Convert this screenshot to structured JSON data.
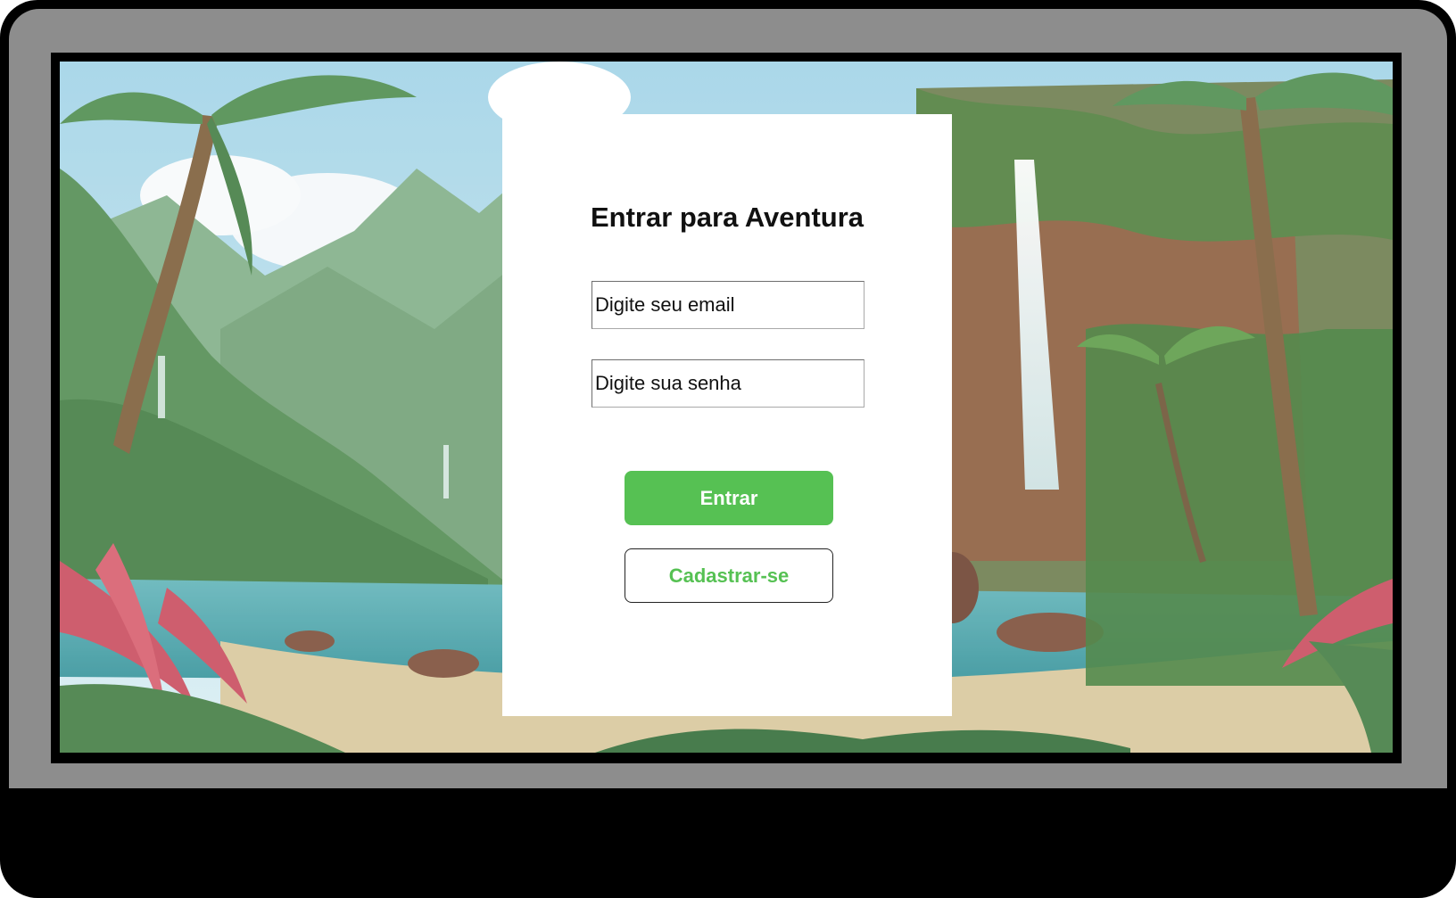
{
  "login": {
    "title": "Entrar para Aventura",
    "email_placeholder": "Digite seu email",
    "password_placeholder": "Digite sua senha",
    "submit_label": "Entrar",
    "signup_label": "Cadastrar-se"
  },
  "colors": {
    "accent": "#56c153",
    "card_background": "#ffffff",
    "bezel": "#8d8d8d",
    "frame": "#000000"
  },
  "icons": [
    "jungle-background-image"
  ]
}
